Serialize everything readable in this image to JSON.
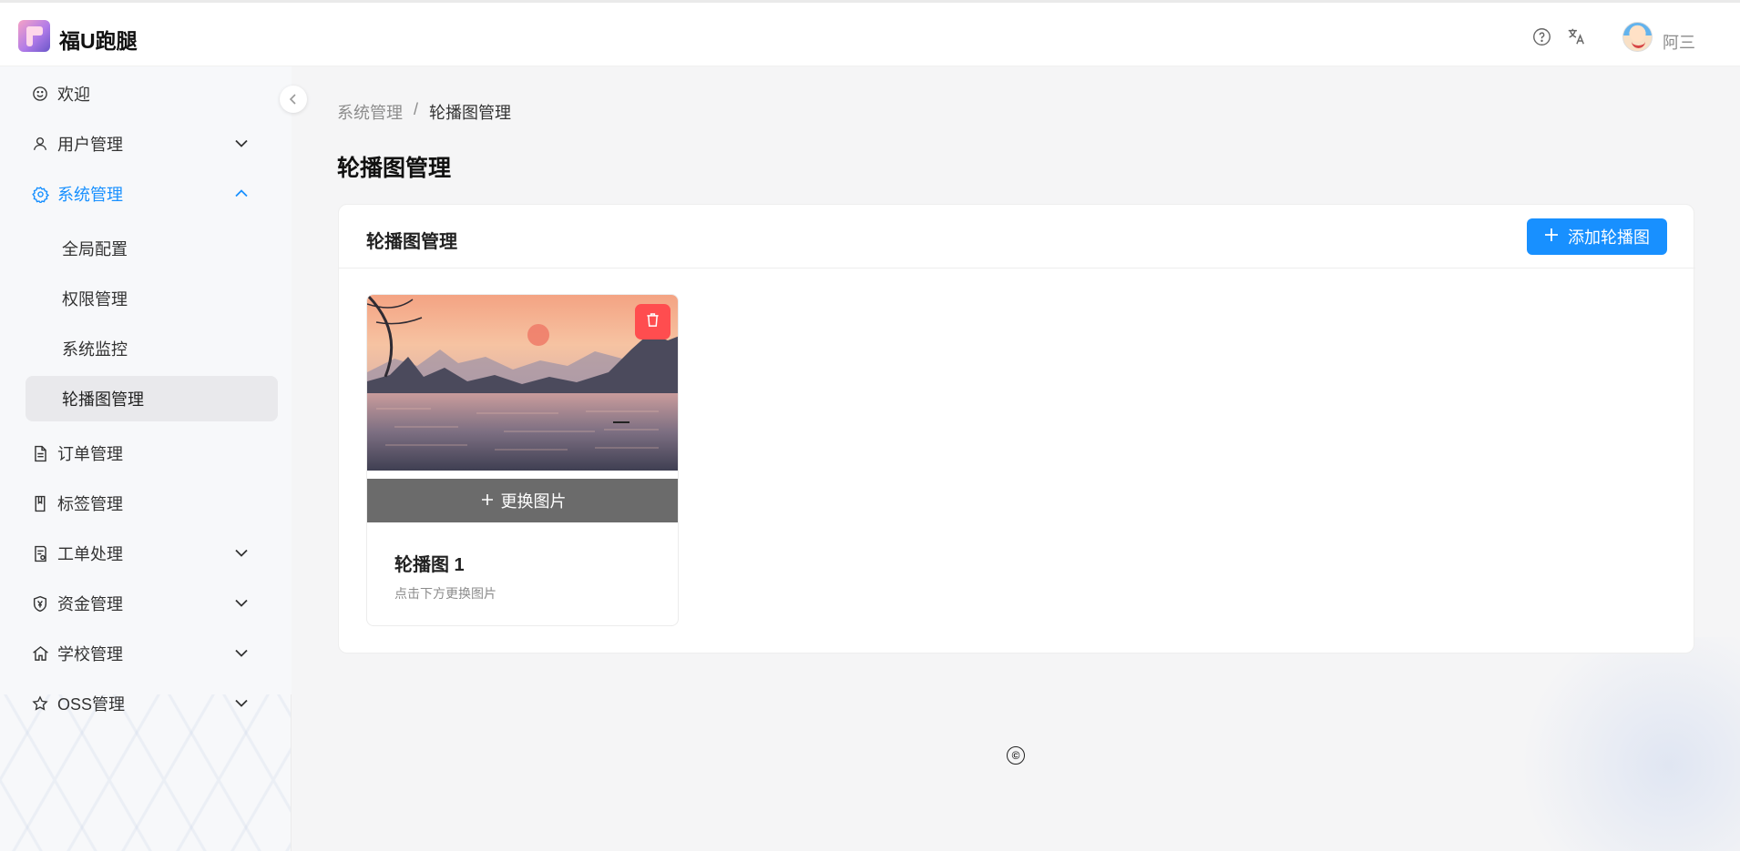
{
  "app": {
    "title": "福U跑腿"
  },
  "header": {
    "username": "阿三",
    "help_icon": "question-circle-icon",
    "translate_icon": "translate-icon"
  },
  "sidebar": {
    "items": [
      {
        "label": "欢迎",
        "icon": "smile-icon"
      },
      {
        "label": "用户管理",
        "icon": "user-icon"
      },
      {
        "label": "系统管理",
        "icon": "gear-icon"
      },
      {
        "label": "订单管理",
        "icon": "file-icon"
      },
      {
        "label": "标签管理",
        "icon": "book-icon"
      },
      {
        "label": "工单处理",
        "icon": "ticket-icon"
      },
      {
        "label": "资金管理",
        "icon": "money-shield-icon"
      },
      {
        "label": "学校管理",
        "icon": "home-icon"
      },
      {
        "label": "OSS管理",
        "icon": "star-icon"
      }
    ],
    "sub_items": [
      {
        "label": "全局配置"
      },
      {
        "label": "权限管理"
      },
      {
        "label": "系统监控"
      },
      {
        "label": "轮播图管理"
      }
    ],
    "accent": "#1890ff"
  },
  "breadcrumb": {
    "parent": "系统管理",
    "separator": "/",
    "current": "轮播图管理"
  },
  "page": {
    "title": "轮播图管理"
  },
  "panel": {
    "title": "轮播图管理",
    "add_button": "添加轮播图",
    "cards": [
      {
        "title": "轮播图 1",
        "desc": "点击下方更换图片",
        "change_label": "更换图片"
      }
    ]
  },
  "footer": {
    "copyright": "©"
  }
}
